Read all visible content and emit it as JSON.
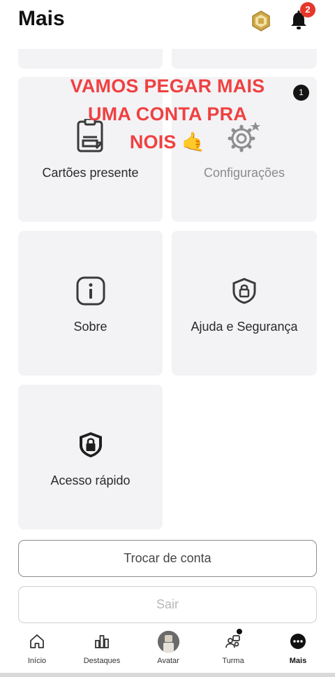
{
  "header": {
    "title": "Mais",
    "notification_count": "2"
  },
  "tiles": [
    {
      "label": "Cartões presente",
      "icon": "gift-card-icon"
    },
    {
      "label": "Configurações",
      "icon": "gear-icon",
      "badge": "1"
    },
    {
      "label": "Sobre",
      "icon": "info-icon"
    },
    {
      "label": "Ajuda e Segurança",
      "icon": "shield-lock-icon"
    },
    {
      "label": "Acesso rápido",
      "icon": "shield-lock-filled-icon"
    }
  ],
  "overlay": {
    "lines": [
      "VAMOS PEGAR MAIS",
      "UMA CONTA PRA",
      "NOIS 🤙"
    ],
    "color": "#ef4141"
  },
  "buttons": {
    "switch_account": "Trocar de conta",
    "logout": "Sair"
  },
  "tabbar": [
    {
      "label": "Início",
      "icon": "home-icon"
    },
    {
      "label": "Destaques",
      "icon": "chart-bars-icon"
    },
    {
      "label": "Avatar",
      "icon": "avatar-icon"
    },
    {
      "label": "Turma",
      "icon": "friends-icon"
    },
    {
      "label": "Mais",
      "icon": "more-icon",
      "active": true
    }
  ],
  "colors": {
    "accent_badge": "#e5372b",
    "tile_bg": "#f3f3f5"
  }
}
